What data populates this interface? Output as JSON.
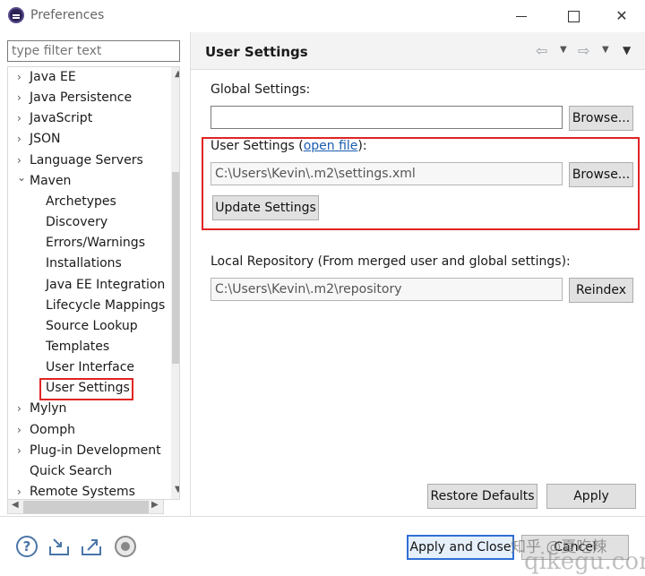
{
  "window": {
    "title": "Preferences"
  },
  "filter": {
    "placeholder": "type filter text"
  },
  "tree": [
    {
      "label": "Java EE",
      "arrow": "›",
      "indent": 0
    },
    {
      "label": "Java Persistence",
      "arrow": "›",
      "indent": 0
    },
    {
      "label": "JavaScript",
      "arrow": "›",
      "indent": 0
    },
    {
      "label": "JSON",
      "arrow": "›",
      "indent": 0
    },
    {
      "label": "Language Servers",
      "arrow": "›",
      "indent": 0
    },
    {
      "label": "Maven",
      "arrow": "⌄",
      "indent": 0
    },
    {
      "label": "Archetypes",
      "arrow": "",
      "indent": 1
    },
    {
      "label": "Discovery",
      "arrow": "",
      "indent": 1
    },
    {
      "label": "Errors/Warnings",
      "arrow": "",
      "indent": 1
    },
    {
      "label": "Installations",
      "arrow": "",
      "indent": 1
    },
    {
      "label": "Java EE Integration",
      "arrow": "",
      "indent": 1
    },
    {
      "label": "Lifecycle Mappings",
      "arrow": "",
      "indent": 1
    },
    {
      "label": "Source Lookup",
      "arrow": "",
      "indent": 1
    },
    {
      "label": "Templates",
      "arrow": "",
      "indent": 1
    },
    {
      "label": "User Interface",
      "arrow": "",
      "indent": 1
    },
    {
      "label": "User Settings",
      "arrow": "",
      "indent": 1,
      "selected": true
    },
    {
      "label": "Mylyn",
      "arrow": "›",
      "indent": 0
    },
    {
      "label": "Oomph",
      "arrow": "›",
      "indent": 0
    },
    {
      "label": "Plug-in Development",
      "arrow": "›",
      "indent": 0
    },
    {
      "label": "Quick Search",
      "arrow": "",
      "indent": 0
    },
    {
      "label": "Remote Systems",
      "arrow": "›",
      "indent": 0
    }
  ],
  "page": {
    "title": "User Settings",
    "global_settings_label": "Global Settings:",
    "global_settings_value": "",
    "user_settings_label_prefix": "User Settings (",
    "user_settings_link": "open file",
    "user_settings_label_suffix": "):",
    "user_settings_value": "C:\\Users\\Kevin\\.m2\\settings.xml",
    "browse_label": "Browse...",
    "update_settings_label": "Update Settings",
    "local_repo_label": "Local Repository (From merged user and global settings):",
    "local_repo_value": "C:\\Users\\Kevin\\.m2\\repository",
    "reindex_label": "Reindex",
    "restore_defaults_label": "Restore Defaults",
    "apply_label": "Apply"
  },
  "footer": {
    "apply_close_label": "Apply and Close",
    "cancel_label": "Cancel",
    "watermark_line1": "知乎 @夏吃辣",
    "watermark_line2": "qikegu.com"
  },
  "colors": {
    "highlight": "#e02424",
    "link": "#1a5db0",
    "primary_border": "#2f6fd6"
  },
  "icons": [
    "app-icon",
    "back-arrow-icon",
    "forward-arrow-icon",
    "view-menu-icon",
    "help-icon",
    "import-icon",
    "export-icon",
    "oomph-icon"
  ]
}
